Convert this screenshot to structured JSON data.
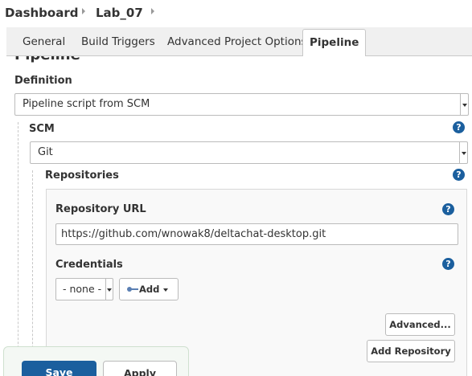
{
  "breadcrumb": {
    "items": [
      "Dashboard",
      "Lab_07"
    ]
  },
  "tabs": [
    {
      "label": "General"
    },
    {
      "label": "Build Triggers"
    },
    {
      "label": "Advanced Project Options"
    },
    {
      "label": "Pipeline"
    }
  ],
  "section": {
    "heading": "Pipeline"
  },
  "definition": {
    "label": "Definition",
    "value": "Pipeline script from SCM"
  },
  "scm": {
    "label": "SCM",
    "value": "Git"
  },
  "repositories": {
    "label": "Repositories",
    "url_label": "Repository URL",
    "url_value": "https://github.com/wnowak8/deltachat-desktop.git",
    "credentials_label": "Credentials",
    "credentials_value": "- none -",
    "add_label": "Add",
    "advanced_label": "Advanced...",
    "add_repository_label": "Add Repository"
  },
  "help_icon": "?",
  "footer": {
    "save_label": "Save",
    "apply_label": "Apply"
  },
  "colors": {
    "primary": "#1b5f9e",
    "border": "#bbbbbb"
  }
}
